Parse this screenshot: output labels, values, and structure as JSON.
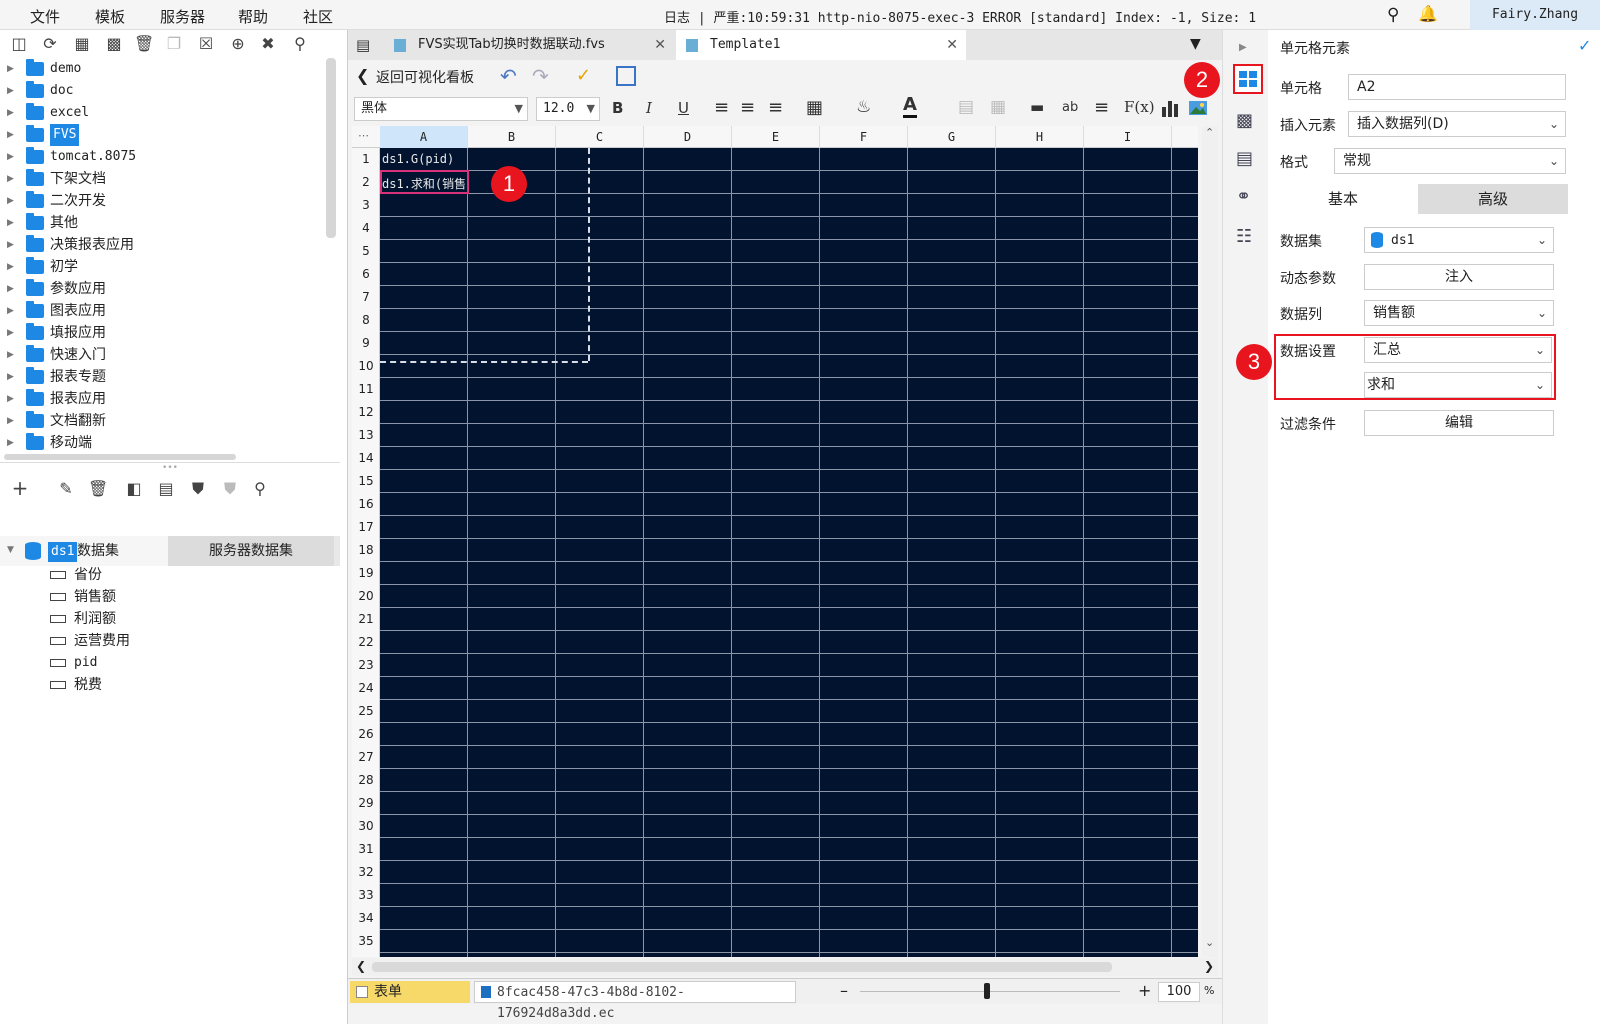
{
  "menubar": {
    "items": [
      "文件",
      "模板",
      "服务器",
      "帮助",
      "社区"
    ],
    "log_text": "日志 | 严重:10:59:31 http-nio-8075-exec-3 ERROR [standard] Index: -1, Size: 1",
    "user": "Fairy.Zhang"
  },
  "file_tree": {
    "items": [
      "demo",
      "doc",
      "excel",
      "FVS",
      "tomcat.8075",
      "下架文档",
      "二次开发",
      "其他",
      "决策报表应用",
      "初学",
      "参数应用",
      "图表应用",
      "填报应用",
      "快速入门",
      "报表专题",
      "报表应用",
      "文档翻新",
      "移动端"
    ],
    "selected": "FVS"
  },
  "datasets": {
    "tabs": [
      "模板数据集",
      "服务器数据集"
    ],
    "active_tab": "模板数据集",
    "dataset_name": "ds1",
    "fields": [
      "省份",
      "销售额",
      "利润额",
      "运营费用",
      "pid",
      "税费"
    ]
  },
  "editor": {
    "doc_tabs": [
      "FVS实现Tab切换时数据联动.fvs",
      "Template1"
    ],
    "active_doc_tab": "Template1",
    "back_label": "返回可视化看板",
    "font_family": "黑体",
    "font_size": "12.0",
    "columns": [
      "A",
      "B",
      "C",
      "D",
      "E",
      "F",
      "G",
      "H",
      "I"
    ],
    "rows": [
      "1",
      "2",
      "3",
      "4",
      "5",
      "6",
      "7",
      "8",
      "9",
      "10",
      "11",
      "12",
      "13",
      "14",
      "15",
      "16",
      "17",
      "18",
      "19",
      "20",
      "21",
      "22",
      "23",
      "24",
      "25",
      "26",
      "27",
      "28",
      "29",
      "30",
      "31",
      "32",
      "33",
      "34",
      "35"
    ],
    "cells": {
      "A1": "ds1.G(pid)",
      "A2": "ds1.求和(销售"
    },
    "sheet_tab": "表单",
    "file_tab": "8fcac458-47c3-4b8d-8102-176924d8a3dd.ec",
    "zoom": "100",
    "zoom_unit": "%"
  },
  "badges": [
    "1",
    "2",
    "3"
  ],
  "right_panel": {
    "title": "单元格元素",
    "cell_label": "单元格",
    "cell_value": "A2",
    "insert_label": "插入元素",
    "insert_value": "插入数据列(D)",
    "format_label": "格式",
    "format_value": "常规",
    "tabs": [
      "基本",
      "高级"
    ],
    "active_tab": "基本",
    "dataset_label": "数据集",
    "dataset_value": "ds1",
    "dynparam_label": "动态参数",
    "dynparam_button": "注入",
    "column_label": "数据列",
    "column_value": "销售额",
    "datasetting_label": "数据设置",
    "datasetting_value": "汇总",
    "agg_value": "求和",
    "filter_label": "过滤条件",
    "filter_button": "编辑"
  },
  "colors": {
    "grid_bg": "#021330",
    "accent": "#1e88e5",
    "badge": "#e8141e",
    "highlight_border": "#e8141e"
  }
}
